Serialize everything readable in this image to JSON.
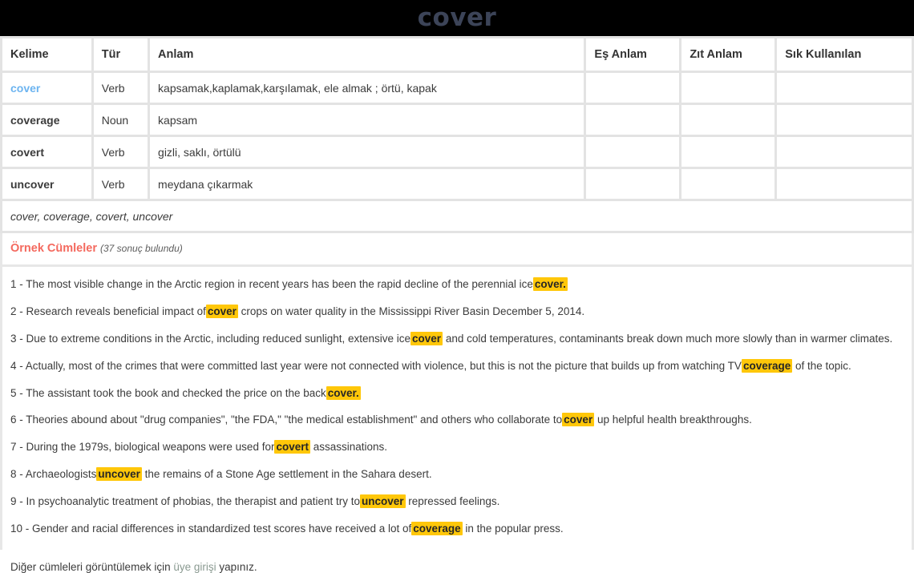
{
  "header": {
    "title": "cover"
  },
  "word_table": {
    "columns": [
      "Kelime",
      "Tür",
      "Anlam",
      "Eş Anlam",
      "Zıt Anlam",
      "Sık Kullanılan"
    ],
    "rows": [
      {
        "kelime": "cover",
        "is_link": true,
        "tur": "Verb",
        "anlam": "kapsamak,kaplamak,karşılamak, ele almak ; örtü, kapak",
        "es_anlam": "",
        "zit_anlam": "",
        "sik_kullanilan": ""
      },
      {
        "kelime": "coverage",
        "is_link": false,
        "tur": "Noun",
        "anlam": "kapsam",
        "es_anlam": "",
        "zit_anlam": "",
        "sik_kullanilan": ""
      },
      {
        "kelime": "covert",
        "is_link": false,
        "tur": "Verb",
        "anlam": "gizli, saklı, örtülü",
        "es_anlam": "",
        "zit_anlam": "",
        "sik_kullanilan": ""
      },
      {
        "kelime": "uncover",
        "is_link": false,
        "tur": "Verb",
        "anlam": "meydana çıkarmak",
        "es_anlam": "",
        "zit_anlam": "",
        "sik_kullanilan": ""
      }
    ],
    "related_words": "cover, coverage, covert, uncover"
  },
  "examples": {
    "title": "Örnek Cümleler",
    "count_text": "(37 sonuç bulundu)",
    "sentences": [
      {
        "number": "1 - ",
        "before": "The most visible change in the Arctic region in recent years has been the rapid decline of the perennial ice",
        "highlight": "cover.",
        "after": ""
      },
      {
        "number": "2 - ",
        "before": "Research reveals beneficial impact of",
        "highlight": "cover",
        "after": " crops on water quality in the Mississippi River Basin December 5, 2014."
      },
      {
        "number": "3 - ",
        "before": "Due to extreme conditions in the Arctic, including reduced sunlight, extensive ice",
        "highlight": "cover",
        "after": " and cold temperatures, contaminants break down much more slowly than in warmer climates."
      },
      {
        "number": "4 - ",
        "before": "Actually, most of the crimes that were committed last year were not connected with violence, but this is not the picture that builds up from watching TV",
        "highlight": "coverage",
        "after": " of the topic."
      },
      {
        "number": "5 - ",
        "before": "The assistant took the book and checked the price on the back",
        "highlight": "cover.",
        "after": ""
      },
      {
        "number": "6 - ",
        "before": "Theories abound about \"drug companies\", \"the FDA,\" \"the medical establishment\" and others who collaborate to",
        "highlight": "cover",
        "after": " up helpful health breakthroughs."
      },
      {
        "number": "7 - ",
        "before": "During the 1979s, biological weapons were used for",
        "highlight": "covert",
        "after": " assassinations."
      },
      {
        "number": "8 - ",
        "before": "Archaeologists",
        "highlight": "uncover",
        "after": " the remains of a Stone Age settlement in the Sahara desert."
      },
      {
        "number": "9 - ",
        "before": "In psychoanalytic treatment of phobias, the therapist and patient try to",
        "highlight": "uncover",
        "after": " repressed feelings."
      },
      {
        "number": "10 - ",
        "before": "Gender and racial differences in standardized test scores have received a lot of",
        "highlight": "coverage",
        "after": " in the popular press."
      }
    ],
    "footer": {
      "before_link": "Diğer cümleleri görüntülemek için ",
      "link": "üye girişi",
      "after_link": " yapınız."
    }
  },
  "colors": {
    "header_bg": "#000000",
    "title": "#3c4458",
    "highlight": "#ffc709",
    "examples_title": "#f4695e",
    "word_link": "#6cb4f0",
    "member_link": "#8a9a91",
    "page_bg": "#e7e7e7"
  }
}
